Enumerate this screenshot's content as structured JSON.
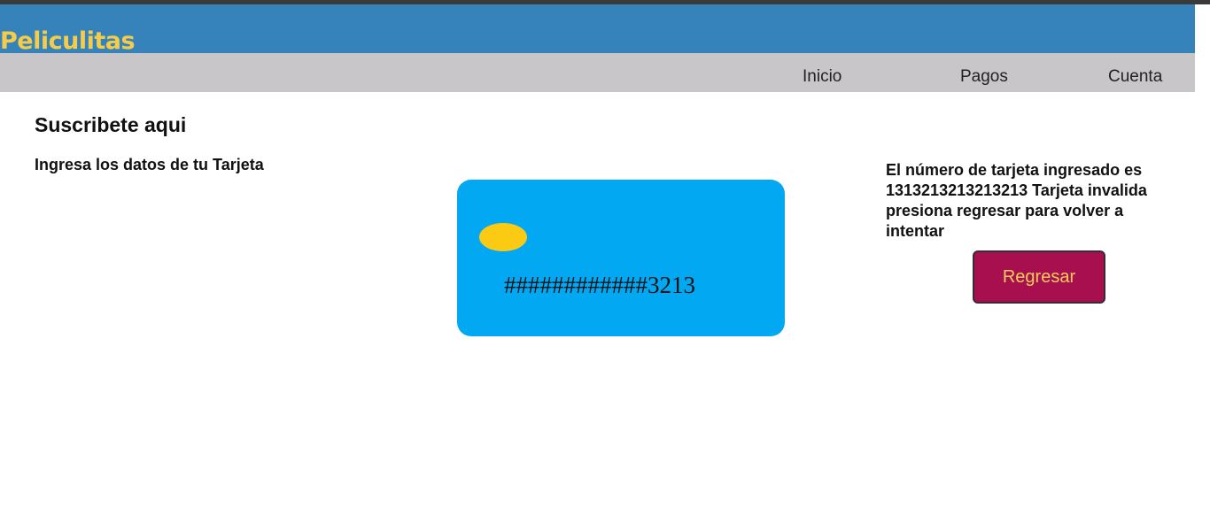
{
  "brand": {
    "name": "Peliculitas"
  },
  "nav": {
    "items": [
      {
        "label": "Inicio"
      },
      {
        "label": "Pagos"
      },
      {
        "label": "Cuenta"
      }
    ]
  },
  "main": {
    "title": "Suscribete aqui",
    "subtitle": "Ingresa los datos de tu Tarjeta",
    "card": {
      "masked_number": "############3213"
    },
    "message": "El número de tarjeta ingresado es 1313213213213213 Tarjeta invalida presiona regresar para volver a intentar",
    "back_button_label": "Regresar"
  },
  "colors": {
    "header_bg": "#3683bb",
    "brand_text": "#f5cc4a",
    "nav_bg": "#c8c6c8",
    "card_bg": "#03a8f3",
    "chip": "#fbcb14",
    "button_bg": "#a80f4e",
    "button_text": "#f5cc5a"
  }
}
